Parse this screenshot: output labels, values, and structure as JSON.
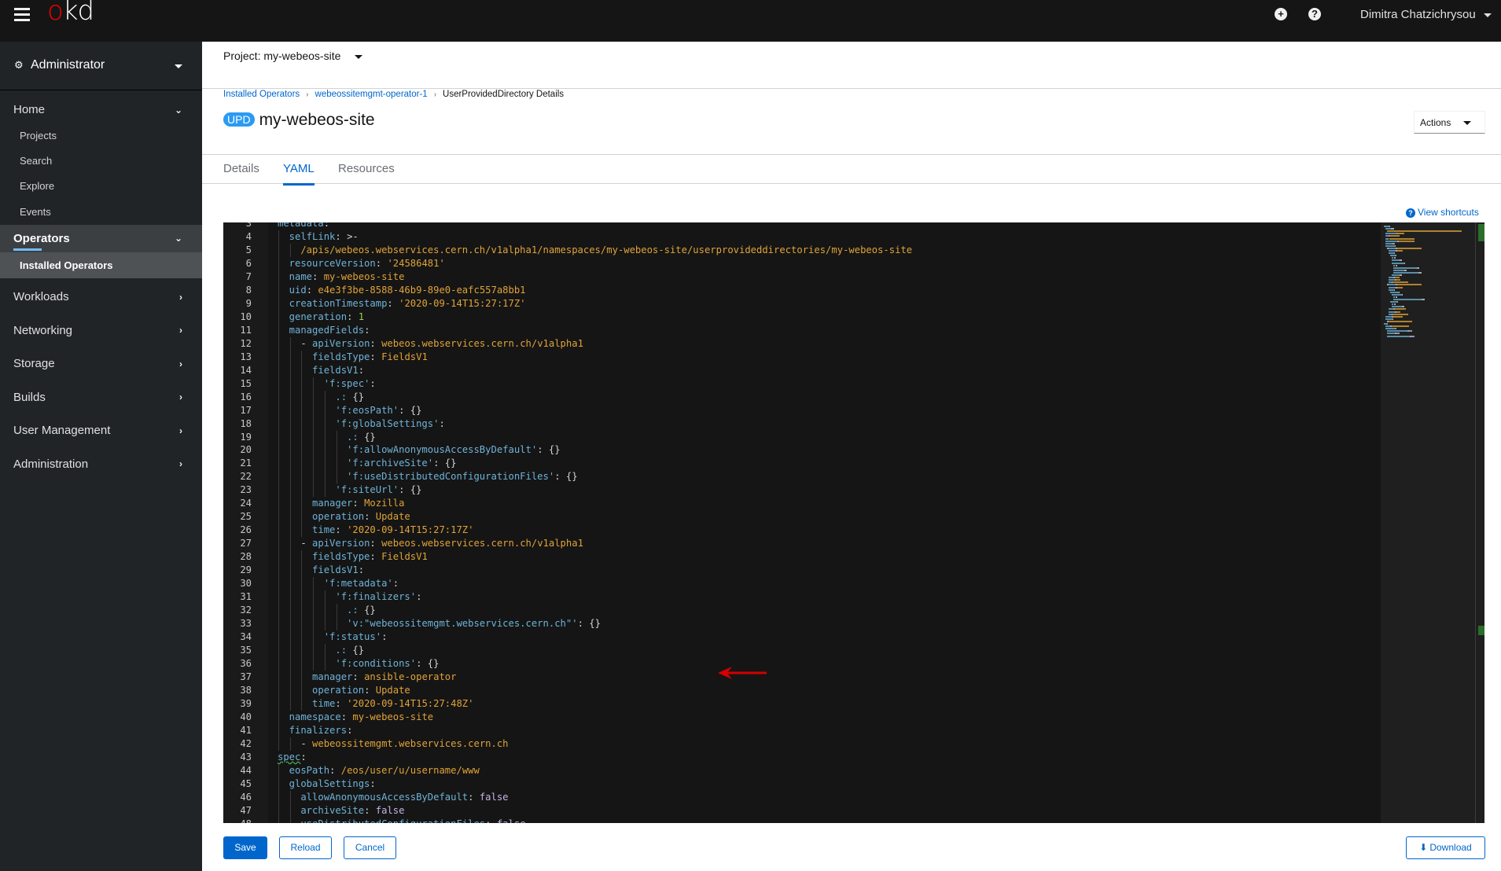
{
  "masthead": {
    "logo_o": "o",
    "logo_rest": "kd",
    "add_icon": "plus-circle-icon",
    "help_icon": "question-circle-icon",
    "user_name": "Dimitra Chatzichrysou"
  },
  "sidebar": {
    "perspective": "Administrator",
    "sections": [
      {
        "label": "Home",
        "expanded": true,
        "items": [
          "Projects",
          "Search",
          "Explore",
          "Events"
        ]
      },
      {
        "label": "Operators",
        "expanded": true,
        "active": true,
        "items": [
          "Installed Operators"
        ]
      },
      {
        "label": "Workloads",
        "expanded": false
      },
      {
        "label": "Networking",
        "expanded": false
      },
      {
        "label": "Storage",
        "expanded": false
      },
      {
        "label": "Builds",
        "expanded": false
      },
      {
        "label": "User Management",
        "expanded": false
      },
      {
        "label": "Administration",
        "expanded": false
      }
    ]
  },
  "project": {
    "label": "Project: my-webeos-site"
  },
  "breadcrumb": [
    {
      "label": "Installed Operators",
      "link": true
    },
    {
      "label": "webeossitemgmt-operator-1",
      "link": true
    },
    {
      "label": "UserProvidedDirectory Details",
      "link": false
    }
  ],
  "page": {
    "badge": "UPD",
    "title": "my-webeos-site",
    "actions_label": "Actions"
  },
  "tabs": [
    {
      "label": "Details",
      "active": false
    },
    {
      "label": "YAML",
      "active": true
    },
    {
      "label": "Resources",
      "active": false
    }
  ],
  "editor": {
    "view_shortcuts": "View shortcuts",
    "first_line_number": 3,
    "lines": [
      [
        [
          "k",
          "metadata"
        ],
        [
          "p",
          ":"
        ]
      ],
      [
        [
          "k",
          "  selfLink"
        ],
        [
          "p",
          ": "
        ],
        [
          "p",
          ">-"
        ]
      ],
      [
        [
          "s",
          "    /apis/webeos.webservices.cern.ch/v1alpha1/namespaces/my-webeos-site/userprovideddirectories/my-webeos-site"
        ]
      ],
      [
        [
          "k",
          "  resourceVersion"
        ],
        [
          "p",
          ": "
        ],
        [
          "s",
          "'24586481'"
        ]
      ],
      [
        [
          "k",
          "  name"
        ],
        [
          "p",
          ": "
        ],
        [
          "s",
          "my-webeos-site"
        ]
      ],
      [
        [
          "k",
          "  uid"
        ],
        [
          "p",
          ": "
        ],
        [
          "s",
          "e4e3f3be-8588-46b9-89e0-eafc557a8bb1"
        ]
      ],
      [
        [
          "k",
          "  creationTimestamp"
        ],
        [
          "p",
          ": "
        ],
        [
          "s",
          "'2020-09-14T15:27:17Z'"
        ]
      ],
      [
        [
          "k",
          "  generation"
        ],
        [
          "p",
          ": "
        ],
        [
          "n",
          "1"
        ]
      ],
      [
        [
          "k",
          "  managedFields"
        ],
        [
          "p",
          ":"
        ]
      ],
      [
        [
          "p",
          "    - "
        ],
        [
          "k",
          "apiVersion"
        ],
        [
          "p",
          ": "
        ],
        [
          "s",
          "webeos.webservices.cern.ch/v1alpha1"
        ]
      ],
      [
        [
          "k",
          "      fieldsType"
        ],
        [
          "p",
          ": "
        ],
        [
          "s",
          "FieldsV1"
        ]
      ],
      [
        [
          "k",
          "      fieldsV1"
        ],
        [
          "p",
          ":"
        ]
      ],
      [
        [
          "k",
          "        'f:spec'"
        ],
        [
          "p",
          ":"
        ]
      ],
      [
        [
          "k",
          "          .:"
        ],
        [
          "p",
          " {}"
        ]
      ],
      [
        [
          "k",
          "          'f:eosPath'"
        ],
        [
          "p",
          ": {}"
        ]
      ],
      [
        [
          "k",
          "          'f:globalSettings'"
        ],
        [
          "p",
          ":"
        ]
      ],
      [
        [
          "k",
          "            .:"
        ],
        [
          "p",
          " {}"
        ]
      ],
      [
        [
          "k",
          "            'f:allowAnonymousAccessByDefault'"
        ],
        [
          "p",
          ": {}"
        ]
      ],
      [
        [
          "k",
          "            'f:archiveSite'"
        ],
        [
          "p",
          ": {}"
        ]
      ],
      [
        [
          "k",
          "            'f:useDistributedConfigurationFiles'"
        ],
        [
          "p",
          ": {}"
        ]
      ],
      [
        [
          "k",
          "          'f:siteUrl'"
        ],
        [
          "p",
          ": {}"
        ]
      ],
      [
        [
          "k",
          "      manager"
        ],
        [
          "p",
          ": "
        ],
        [
          "s",
          "Mozilla"
        ]
      ],
      [
        [
          "k",
          "      operation"
        ],
        [
          "p",
          ": "
        ],
        [
          "s",
          "Update"
        ]
      ],
      [
        [
          "k",
          "      time"
        ],
        [
          "p",
          ": "
        ],
        [
          "s",
          "'2020-09-14T15:27:17Z'"
        ]
      ],
      [
        [
          "p",
          "    - "
        ],
        [
          "k",
          "apiVersion"
        ],
        [
          "p",
          ": "
        ],
        [
          "s",
          "webeos.webservices.cern.ch/v1alpha1"
        ]
      ],
      [
        [
          "k",
          "      fieldsType"
        ],
        [
          "p",
          ": "
        ],
        [
          "s",
          "FieldsV1"
        ]
      ],
      [
        [
          "k",
          "      fieldsV1"
        ],
        [
          "p",
          ":"
        ]
      ],
      [
        [
          "k",
          "        'f:metadata'"
        ],
        [
          "p",
          ":"
        ]
      ],
      [
        [
          "k",
          "          'f:finalizers'"
        ],
        [
          "p",
          ":"
        ]
      ],
      [
        [
          "k",
          "            .:"
        ],
        [
          "p",
          " {}"
        ]
      ],
      [
        [
          "k",
          "            'v:\"webeossitemgmt.webservices.cern.ch\"'"
        ],
        [
          "p",
          ": {}"
        ]
      ],
      [
        [
          "k",
          "        'f:status'"
        ],
        [
          "p",
          ":"
        ]
      ],
      [
        [
          "k",
          "          .:"
        ],
        [
          "p",
          " {}"
        ]
      ],
      [
        [
          "k",
          "          'f:conditions'"
        ],
        [
          "p",
          ": {}"
        ]
      ],
      [
        [
          "k",
          "      manager"
        ],
        [
          "p",
          ": "
        ],
        [
          "s",
          "ansible-operator"
        ]
      ],
      [
        [
          "k",
          "      operation"
        ],
        [
          "p",
          ": "
        ],
        [
          "s",
          "Update"
        ]
      ],
      [
        [
          "k",
          "      time"
        ],
        [
          "p",
          ": "
        ],
        [
          "s",
          "'2020-09-14T15:27:48Z'"
        ]
      ],
      [
        [
          "k",
          "  namespace"
        ],
        [
          "p",
          ": "
        ],
        [
          "s",
          "my-webeos-site"
        ]
      ],
      [
        [
          "k",
          "  finalizers"
        ],
        [
          "p",
          ":"
        ]
      ],
      [
        [
          "p",
          "    - "
        ],
        [
          "s",
          "webeossitemgmt.webservices.cern.ch"
        ]
      ],
      [
        [
          "k",
          "spec"
        ],
        [
          "p",
          ":"
        ]
      ],
      [
        [
          "k",
          "  eosPath"
        ],
        [
          "p",
          ": "
        ],
        [
          "s",
          "/eos/user/u/username/www"
        ]
      ],
      [
        [
          "k",
          "  globalSettings"
        ],
        [
          "p",
          ":"
        ]
      ],
      [
        [
          "k",
          "    allowAnonymousAccessByDefault"
        ],
        [
          "p",
          ": "
        ],
        [
          "b",
          "false"
        ]
      ],
      [
        [
          "k",
          "    archiveSite"
        ],
        [
          "p",
          ": "
        ],
        [
          "b",
          "false"
        ]
      ],
      [
        [
          "k",
          "    useDistributedConfigurationFiles"
        ],
        [
          "p",
          ": "
        ],
        [
          "b",
          "false"
        ]
      ]
    ],
    "annotation": "red-arrow-pointing-at-eosPath"
  },
  "footer": {
    "save": "Save",
    "reload": "Reload",
    "cancel": "Cancel",
    "download": "Download"
  },
  "colors": {
    "masthead_bg": "#151515",
    "sidebar_bg": "#212427",
    "accent": "#0066cc",
    "logo_red": "#ee0000",
    "badge_blue": "#2b9af3",
    "yaml_key": "#6fb3d8",
    "yaml_string": "#e0a338",
    "yaml_number": "#9acd59",
    "yaml_boolean": "#c5b4e4"
  }
}
